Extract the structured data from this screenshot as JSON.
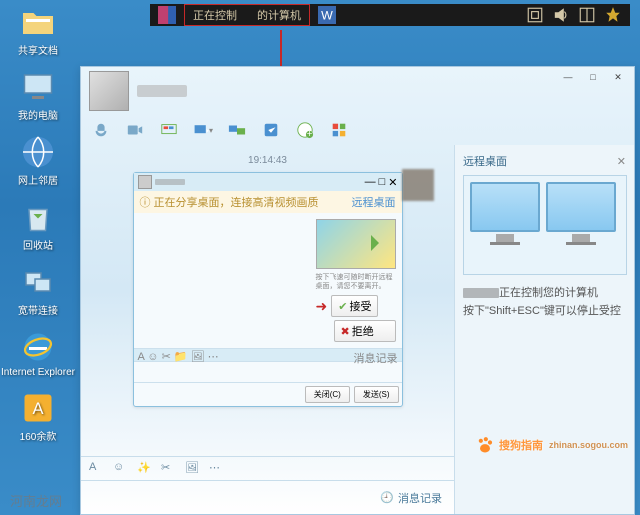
{
  "desktop": {
    "icons": [
      {
        "label": "共享文档",
        "name": "shared-docs-icon"
      },
      {
        "label": "我的电脑",
        "name": "my-computer-icon"
      },
      {
        "label": "网上邻居",
        "name": "network-places-icon"
      },
      {
        "label": "回收站",
        "name": "recycle-bin-icon"
      },
      {
        "label": "宽带连接",
        "name": "broadband-icon"
      },
      {
        "label": "Internet Explorer",
        "name": "ie-icon"
      },
      {
        "label": "160余款",
        "name": "apps-icon"
      }
    ]
  },
  "topbar": {
    "highlight1": "正在控制",
    "highlight2": "的计算机"
  },
  "chat": {
    "timestamp": "19:14:43",
    "sidepanel": {
      "title": "远程桌面",
      "status_suffix": "正在控制您的计算机",
      "hint": "按下\"Shift+ESC\"键可以停止受控"
    },
    "nested": {
      "tip": "正在分享桌面，连接高清视频画质",
      "right_link": "远程桌面",
      "desc": "按下飞速可随时断开远程桌面，请您不要离开。",
      "btn_accept": "接受",
      "btn_reject": "拒绝",
      "foot_close": "关闭(C)",
      "foot_send": "发送(S)",
      "history": "消息记录"
    },
    "history_label": "消息记录"
  },
  "watermark": {
    "main": "搜狗指南",
    "sub": "zhinan.sogou.com",
    "bottom": "河南龙网"
  }
}
